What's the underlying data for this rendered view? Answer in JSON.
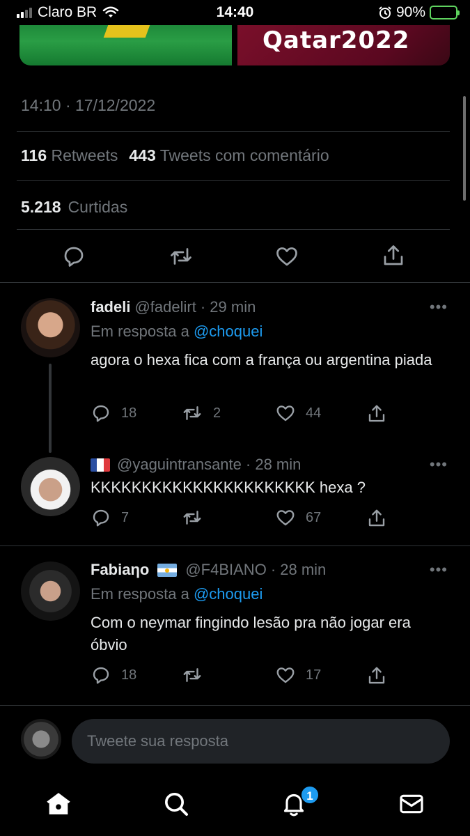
{
  "status_bar": {
    "carrier": "Claro BR",
    "time": "14:40",
    "battery": "90%",
    "battery_level": 0.9
  },
  "media": {
    "right_text": "Qatar2022"
  },
  "tweet": {
    "timestamp": "14:10 · 17/12/2022",
    "retweets_count": "116",
    "retweets_label": "Retweets",
    "quotes_count": "443",
    "quotes_label": "Tweets com comentário",
    "likes_count": "5.218",
    "likes_label": "Curtidas"
  },
  "replies": [
    {
      "name": "fadeli",
      "handle": "@fadelirt",
      "time": "· 29 min",
      "reply_prefix": "Em resposta a",
      "reply_to": "@choquei",
      "text": "agora o hexa fica com a frança ou argentina piada",
      "comments": "18",
      "retweets": "2",
      "likes": "44"
    },
    {
      "handle": "@yaguintransante",
      "time": "· 28 min",
      "text": "KKKKKKKKKKKKKKKKKKKKKK hexa ?",
      "comments": "7",
      "retweets": "",
      "likes": "67"
    },
    {
      "name": "Fabiaηo",
      "handle": "@F4BIANO",
      "time": "· 28 min",
      "reply_prefix": "Em resposta a",
      "reply_to": "@choquei",
      "text": "Com o neymar fingindo lesão pra não jogar era óbvio",
      "comments": "18",
      "retweets": "",
      "likes": "17"
    }
  ],
  "more_glyph": "•••",
  "compose": {
    "placeholder": "Tweete sua resposta"
  },
  "tabbar": {
    "notifications_badge": "1"
  },
  "colors": {
    "accent": "#1d9bf0",
    "background": "#000000",
    "muted": "#71767b",
    "divider": "#2f3336"
  }
}
